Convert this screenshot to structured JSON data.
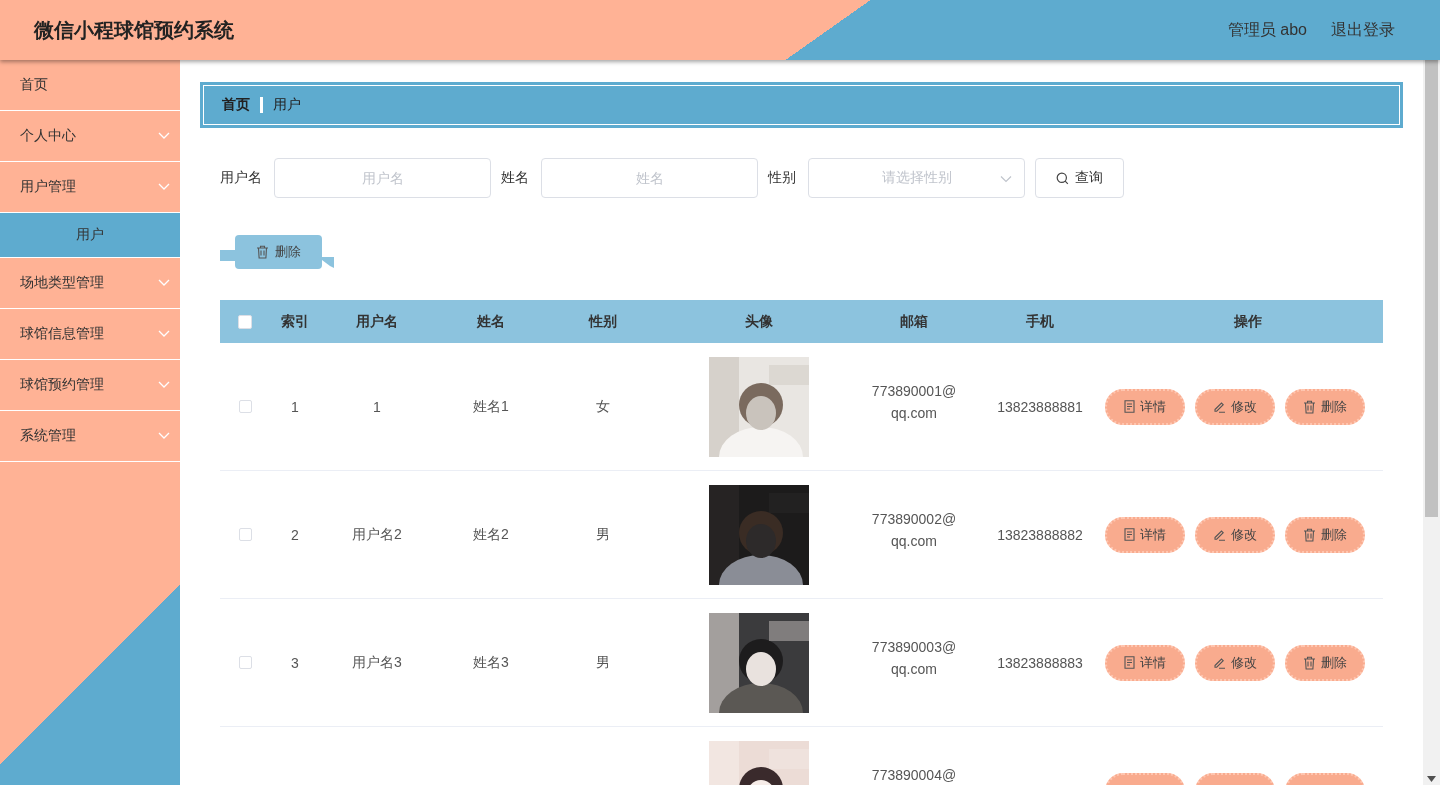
{
  "header": {
    "title": "微信小程球馆预约系统",
    "user": "管理员 abo",
    "logout": "退出登录"
  },
  "sidebar": {
    "items": [
      {
        "label": "首页",
        "kind": "link",
        "selected": false
      },
      {
        "label": "个人中心",
        "kind": "submenu",
        "selected": false
      },
      {
        "label": "用户管理",
        "kind": "submenu",
        "selected": false,
        "children": [
          {
            "label": "用户",
            "selected": true
          }
        ]
      },
      {
        "label": "场地类型管理",
        "kind": "submenu",
        "selected": false
      },
      {
        "label": "球馆信息管理",
        "kind": "submenu",
        "selected": false
      },
      {
        "label": "球馆预约管理",
        "kind": "submenu",
        "selected": false
      },
      {
        "label": "系统管理",
        "kind": "submenu",
        "selected": false
      }
    ]
  },
  "breadcrumb": [
    "首页",
    "用户"
  ],
  "search": {
    "fields": [
      {
        "label": "用户名",
        "kind": "input",
        "placeholder": "用户名"
      },
      {
        "label": "姓名",
        "kind": "input",
        "placeholder": "姓名"
      },
      {
        "label": "性别",
        "kind": "select",
        "placeholder": "请选择性别"
      }
    ],
    "button": "查询"
  },
  "bulk_delete": "删除",
  "table": {
    "select_all": {
      "checked": false
    },
    "columns": [
      "索引",
      "用户名",
      "姓名",
      "性别",
      "头像",
      "邮箱",
      "手机",
      "操作"
    ],
    "rows": [
      {
        "checked": false,
        "index": "1",
        "username": "1",
        "name": "姓名1",
        "gender": "女",
        "avatar": {
          "kind": "picture"
        },
        "email": "773890001@qq.com",
        "phone": "13823888881",
        "actions": [
          {
            "kind": "detail",
            "label": "详情"
          },
          {
            "kind": "edit",
            "label": "修改"
          },
          {
            "kind": "delete",
            "label": "删除"
          }
        ]
      },
      {
        "checked": false,
        "index": "2",
        "username": "用户名2",
        "name": "姓名2",
        "gender": "男",
        "avatar": {
          "kind": "picture"
        },
        "email": "773890002@qq.com",
        "phone": "13823888882",
        "actions": [
          {
            "kind": "detail",
            "label": "详情"
          },
          {
            "kind": "edit",
            "label": "修改"
          },
          {
            "kind": "delete",
            "label": "删除"
          }
        ]
      },
      {
        "checked": false,
        "index": "3",
        "username": "用户名3",
        "name": "姓名3",
        "gender": "男",
        "avatar": {
          "kind": "picture"
        },
        "email": "773890003@qq.com",
        "phone": "13823888883",
        "actions": [
          {
            "kind": "detail",
            "label": "详情"
          },
          {
            "kind": "edit",
            "label": "修改"
          },
          {
            "kind": "delete",
            "label": "删除"
          }
        ]
      },
      {
        "avatar": {
          "kind": "picture"
        },
        "email": "773890004@",
        "actions": [
          {
            "kind": "detail"
          },
          {
            "kind": "edit"
          },
          {
            "kind": "delete"
          }
        ]
      }
    ]
  }
}
